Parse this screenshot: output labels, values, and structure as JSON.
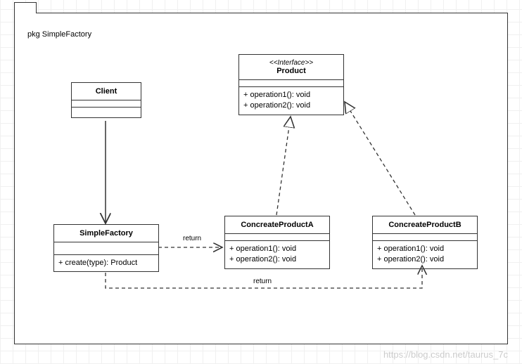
{
  "package_label": "pkg SimpleFactory",
  "classes": {
    "client": {
      "name": "Client"
    },
    "product": {
      "stereotype": "<<Interface>>",
      "name": "Product",
      "ops": [
        "+ operation1(): void",
        "+ operation2(): void"
      ]
    },
    "factory": {
      "name": "SimpleFactory",
      "ops": [
        "+ create(type): Product"
      ]
    },
    "prodA": {
      "name": "ConcreateProductA",
      "ops": [
        "+ operation1(): void",
        "+ operation2(): void"
      ]
    },
    "prodB": {
      "name": "ConcreateProductB",
      "ops": [
        "+ operation1(): void",
        "+ operation2(): void"
      ]
    }
  },
  "edge_labels": {
    "return1": "return",
    "return2": "return"
  },
  "watermark": "https://blog.csdn.net/taurus_7c",
  "chart_data": {
    "type": "uml-class-diagram",
    "package": "SimpleFactory",
    "nodes": [
      {
        "id": "Client",
        "kind": "class",
        "attributes": [],
        "operations": []
      },
      {
        "id": "Product",
        "kind": "interface",
        "attributes": [],
        "operations": [
          "+ operation1(): void",
          "+ operation2(): void"
        ]
      },
      {
        "id": "SimpleFactory",
        "kind": "class",
        "attributes": [],
        "operations": [
          "+ create(type): Product"
        ]
      },
      {
        "id": "ConcreateProductA",
        "kind": "class",
        "attributes": [],
        "operations": [
          "+ operation1(): void",
          "+ operation2(): void"
        ]
      },
      {
        "id": "ConcreateProductB",
        "kind": "class",
        "attributes": [],
        "operations": [
          "+ operation1(): void",
          "+ operation2(): void"
        ]
      }
    ],
    "edges": [
      {
        "from": "Client",
        "to": "SimpleFactory",
        "type": "association",
        "style": "solid",
        "arrow": "open"
      },
      {
        "from": "SimpleFactory",
        "to": "ConcreateProductA",
        "type": "dependency",
        "style": "dashed",
        "arrow": "open",
        "label": "return"
      },
      {
        "from": "SimpleFactory",
        "to": "ConcreateProductB",
        "type": "dependency",
        "style": "dashed",
        "arrow": "open",
        "label": "return"
      },
      {
        "from": "ConcreateProductA",
        "to": "Product",
        "type": "realization",
        "style": "dashed",
        "arrow": "hollow"
      },
      {
        "from": "ConcreateProductB",
        "to": "Product",
        "type": "realization",
        "style": "dashed",
        "arrow": "hollow"
      }
    ]
  }
}
